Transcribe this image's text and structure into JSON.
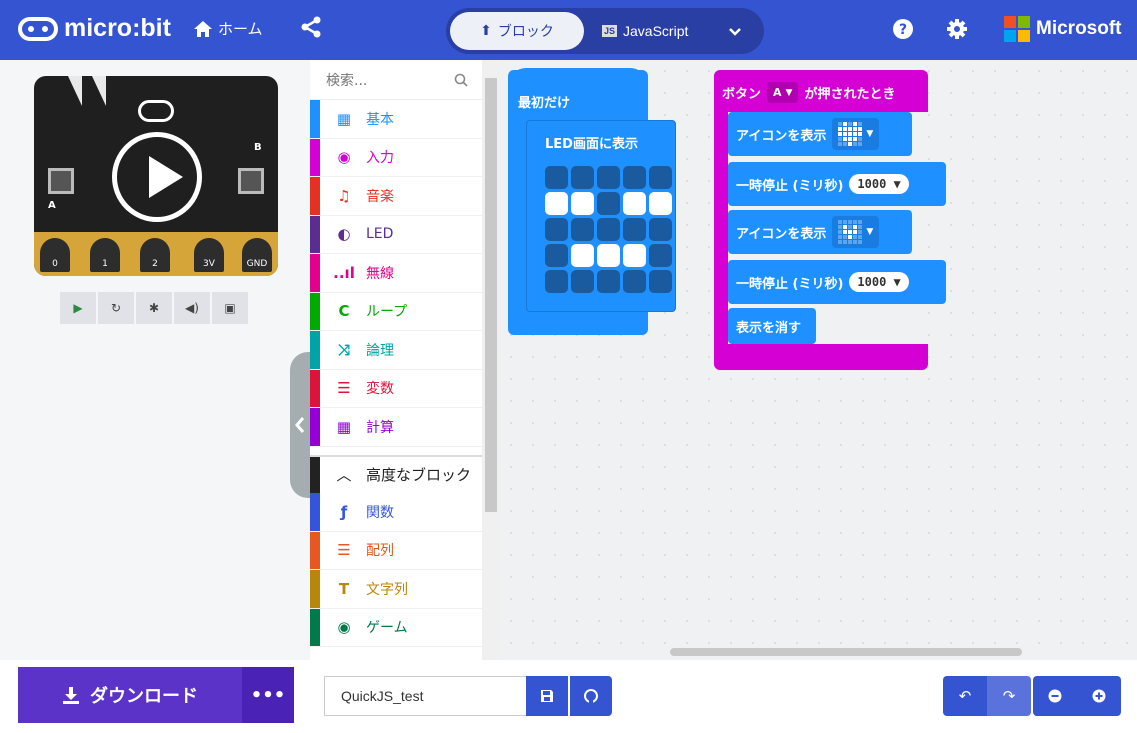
{
  "header": {
    "logo_text": "micro:bit",
    "home_label": "ホーム",
    "mode_blocks_label": "ブロック",
    "mode_js_label": "JavaScript",
    "brand_label": "Microsoft"
  },
  "simulator": {
    "pins": [
      "0",
      "1",
      "2",
      "3V",
      "GND"
    ],
    "btn_a": "A",
    "btn_b": "B"
  },
  "toolbox": {
    "search_placeholder": "検索...",
    "categories": [
      {
        "label": "基本",
        "color": "#1e90ff"
      },
      {
        "label": "入力",
        "color": "#d400d4"
      },
      {
        "label": "音楽",
        "color": "#e63022"
      },
      {
        "label": "LED",
        "color": "#5c2d91"
      },
      {
        "label": "無線",
        "color": "#e3008c"
      },
      {
        "label": "ループ",
        "color": "#00aa00"
      },
      {
        "label": "論理",
        "color": "#00a4a6"
      },
      {
        "label": "変数",
        "color": "#dc143c"
      },
      {
        "label": "計算",
        "color": "#9400d3"
      }
    ],
    "advanced_label": "高度なブロック",
    "advanced": [
      {
        "label": "関数",
        "color": "#3455db"
      },
      {
        "label": "配列",
        "color": "#e65722"
      },
      {
        "label": "文字列",
        "color": "#b8860b"
      },
      {
        "label": "ゲーム",
        "color": "#007a4b"
      }
    ]
  },
  "workspace": {
    "on_start": "最初だけ",
    "show_leds": "LED画面に表示",
    "led_grid": [
      0,
      0,
      0,
      0,
      0,
      1,
      1,
      0,
      1,
      1,
      0,
      0,
      0,
      0,
      0,
      0,
      1,
      1,
      1,
      0,
      0,
      0,
      0,
      0,
      0
    ],
    "event_prefix": "ボタン",
    "event_button": "A",
    "event_suffix": "が押されたとき",
    "show_icon_1": "アイコンを表示",
    "pause_1": "一時停止 (ミリ秒)",
    "pause_1_value": "1000",
    "show_icon_2": "アイコンを表示",
    "pause_2": "一時停止 (ミリ秒)",
    "pause_2_value": "1000",
    "clear_screen": "表示を消す"
  },
  "footer": {
    "download_label": "ダウンロード",
    "more_label": "•••",
    "project_name": "QuickJS_test"
  }
}
